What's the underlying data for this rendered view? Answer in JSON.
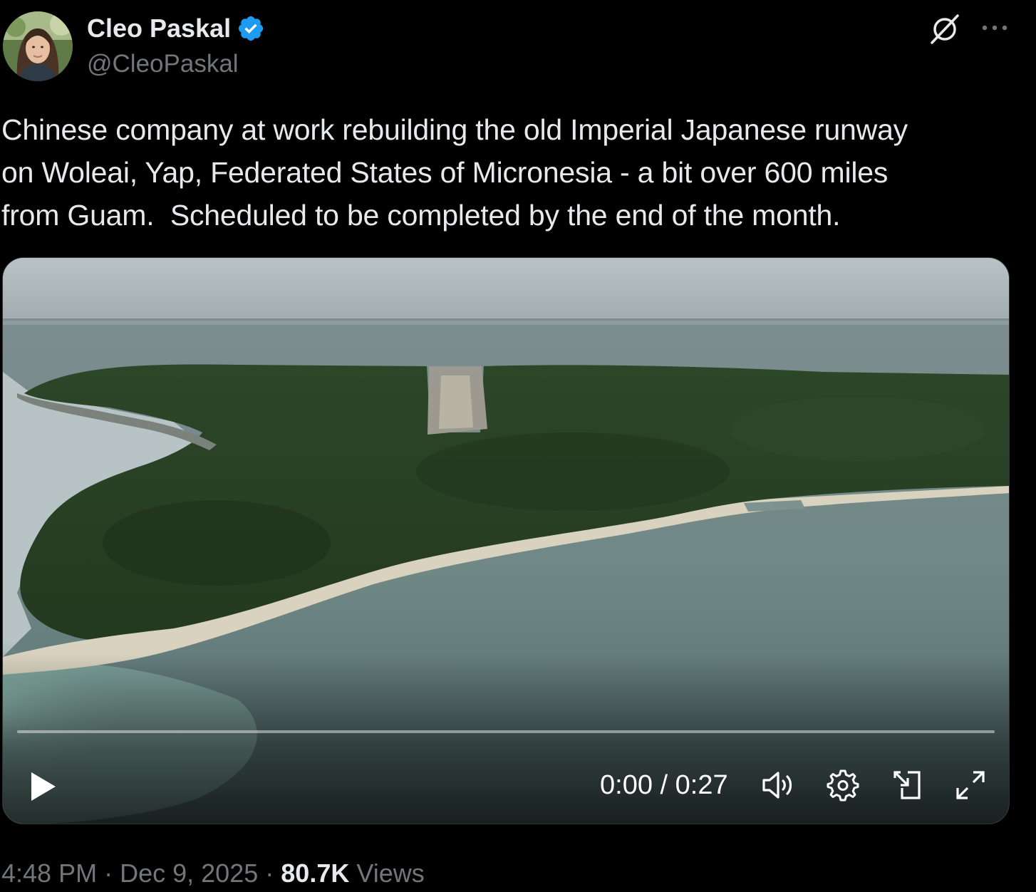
{
  "author": {
    "name": "Cleo Paskal",
    "handle": "@CleoPaskal",
    "verified": true,
    "verified_color": "#1d9bf0"
  },
  "header_icons": {
    "grok": "grok-slash-circle-icon",
    "more": "more-horizontal-icon"
  },
  "tweet": {
    "text": "Chinese company at work rebuilding the old Imperial Japanese runway\non Woleai, Yap, Federated States of Micronesia - a bit over 600 miles\nfrom Guam.  Scheduled to be completed by the end of the month."
  },
  "video": {
    "time": "0:00 / 0:27",
    "progress": 0,
    "icons": {
      "play": "play-icon",
      "volume": "volume-icon",
      "settings": "settings-gear-icon",
      "pip": "picture-in-picture-icon",
      "fullscreen": "fullscreen-expand-icon"
    }
  },
  "footer": {
    "time": "4:48 PM",
    "date": "Dec 9, 2025",
    "separator": "·",
    "views_count": "80.7K",
    "views_label": "Views"
  }
}
